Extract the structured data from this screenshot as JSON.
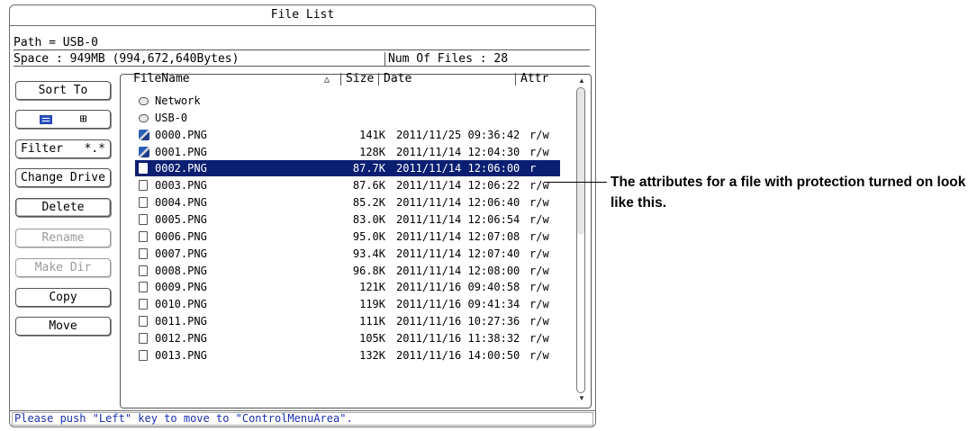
{
  "window": {
    "title": "File List",
    "path_label": "Path = USB-0",
    "space_label": "Space : 949MB (994,672,640Bytes)",
    "num_files_label": "Num Of Files : 28",
    "status_message": "Please push \"Left\" key to move to \"ControlMenuArea\"."
  },
  "side_buttons": {
    "sort_to": "Sort To",
    "filter": "Filter",
    "filter_value": "*.*",
    "change_drive": "Change Drive",
    "delete": "Delete",
    "rename": "Rename",
    "make_dir": "Make Dir",
    "copy": "Copy",
    "move": "Move",
    "view_list_icon": "list-view-icon",
    "view_grid_icon": "grid-view-icon"
  },
  "file_list": {
    "columns": {
      "filename": "FileName",
      "sort_indicator": "△",
      "size": "Size",
      "date": "Date",
      "attr": "Attr"
    },
    "entries": [
      {
        "kind": "drive",
        "name": "Network"
      },
      {
        "kind": "drive",
        "name": "USB-0"
      },
      {
        "kind": "image",
        "name": "0000.PNG",
        "size": "141K",
        "date": "2011/11/25 09:36:42",
        "attr": "r/w"
      },
      {
        "kind": "image",
        "name": "0001.PNG",
        "size": "128K",
        "date": "2011/11/14 12:04:30",
        "attr": "r/w"
      },
      {
        "kind": "file",
        "name": "0002.PNG",
        "size": "87.7K",
        "date": "2011/11/14 12:06:00",
        "attr": "r",
        "selected": true
      },
      {
        "kind": "file",
        "name": "0003.PNG",
        "size": "87.6K",
        "date": "2011/11/14 12:06:22",
        "attr": "r/w"
      },
      {
        "kind": "file",
        "name": "0004.PNG",
        "size": "85.2K",
        "date": "2011/11/14 12:06:40",
        "attr": "r/w"
      },
      {
        "kind": "file",
        "name": "0005.PNG",
        "size": "83.0K",
        "date": "2011/11/14 12:06:54",
        "attr": "r/w"
      },
      {
        "kind": "file",
        "name": "0006.PNG",
        "size": "95.0K",
        "date": "2011/11/14 12:07:08",
        "attr": "r/w"
      },
      {
        "kind": "file",
        "name": "0007.PNG",
        "size": "93.4K",
        "date": "2011/11/14 12:07:40",
        "attr": "r/w"
      },
      {
        "kind": "file",
        "name": "0008.PNG",
        "size": "96.8K",
        "date": "2011/11/14 12:08:00",
        "attr": "r/w"
      },
      {
        "kind": "file",
        "name": "0009.PNG",
        "size": "121K",
        "date": "2011/11/16 09:40:58",
        "attr": "r/w"
      },
      {
        "kind": "file",
        "name": "0010.PNG",
        "size": "119K",
        "date": "2011/11/16 09:41:34",
        "attr": "r/w"
      },
      {
        "kind": "file",
        "name": "0011.PNG",
        "size": "111K",
        "date": "2011/11/16 10:27:36",
        "attr": "r/w"
      },
      {
        "kind": "file",
        "name": "0012.PNG",
        "size": "105K",
        "date": "2011/11/16 11:38:32",
        "attr": "r/w"
      },
      {
        "kind": "file",
        "name": "0013.PNG",
        "size": "132K",
        "date": "2011/11/16 14:00:50",
        "attr": "r/w"
      }
    ]
  },
  "callout": {
    "text": "The attributes for a file with protection turned on look like this."
  },
  "colors": {
    "selection": "#0b1f72",
    "status_text": "#1a2fb0",
    "list_view_icon": "#2f56c6"
  }
}
